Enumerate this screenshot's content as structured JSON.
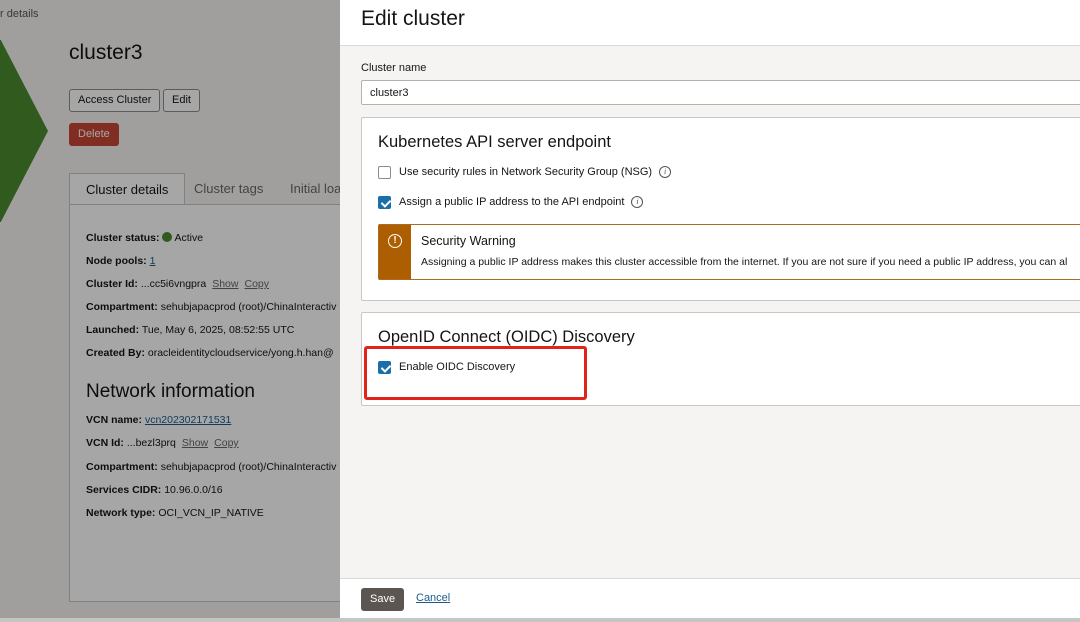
{
  "background": {
    "breadcrumb": "r details",
    "cluster_title": "cluster3",
    "buttons": {
      "access": "Access Cluster",
      "edit": "Edit",
      "delete": "Delete"
    },
    "tabs": [
      "Cluster details",
      "Cluster tags",
      "Initial loa"
    ],
    "details": {
      "status_label": "Cluster status:",
      "status_value": "Active",
      "node_pools_label": "Node pools:",
      "node_pools_value": "1",
      "cluster_id_label": "Cluster Id:",
      "cluster_id_value": "...cc5i6vngpra",
      "show": "Show",
      "copy": "Copy",
      "compartment_label": "Compartment:",
      "compartment_value": "sehubjapacprod (root)/ChinaInteractiv",
      "launched_label": "Launched:",
      "launched_value": "Tue, May 6, 2025, 08:52:55 UTC",
      "created_by_label": "Created By:",
      "created_by_value": "oracleidentitycloudservice/yong.h.han@"
    },
    "network": {
      "title": "Network information",
      "vcn_name_label": "VCN name:",
      "vcn_name_value": "vcn202302171531",
      "vcn_id_label": "VCN Id:",
      "vcn_id_value": "...bezl3prq",
      "compartment_label": "Compartment:",
      "compartment_value": "sehubjapacprod (root)/ChinaInteractiv",
      "services_cidr_label": "Services CIDR:",
      "services_cidr_value": "10.96.0.0/16",
      "network_type_label": "Network type:",
      "network_type_value": "OCI_VCN_IP_NATIVE"
    }
  },
  "drawer": {
    "title": "Edit cluster",
    "cluster_name_label": "Cluster name",
    "cluster_name_value": "cluster3",
    "api_endpoint": {
      "title": "Kubernetes API server endpoint",
      "nsg_label": "Use security rules in Network Security Group (NSG)",
      "nsg_checked": false,
      "public_ip_label": "Assign a public IP address to the API endpoint",
      "public_ip_checked": true,
      "warning_title": "Security Warning",
      "warning_text": "Assigning a public IP address makes this cluster accessible from the internet. If you are not sure if you need a public IP address, you can al"
    },
    "oidc": {
      "title": "OpenID Connect (OIDC) Discovery",
      "enable_label": "Enable OIDC Discovery",
      "enable_checked": true
    },
    "footer": {
      "save": "Save",
      "cancel": "Cancel"
    }
  },
  "colors": {
    "accent": "#1a6fa8",
    "warning": "#ad5e00",
    "danger": "#c74634",
    "highlight": "#e2231a",
    "status_active": "#4c8a2f"
  },
  "icons": {
    "info": "info-icon",
    "warning": "warning-icon",
    "status": "status-dot-icon"
  }
}
